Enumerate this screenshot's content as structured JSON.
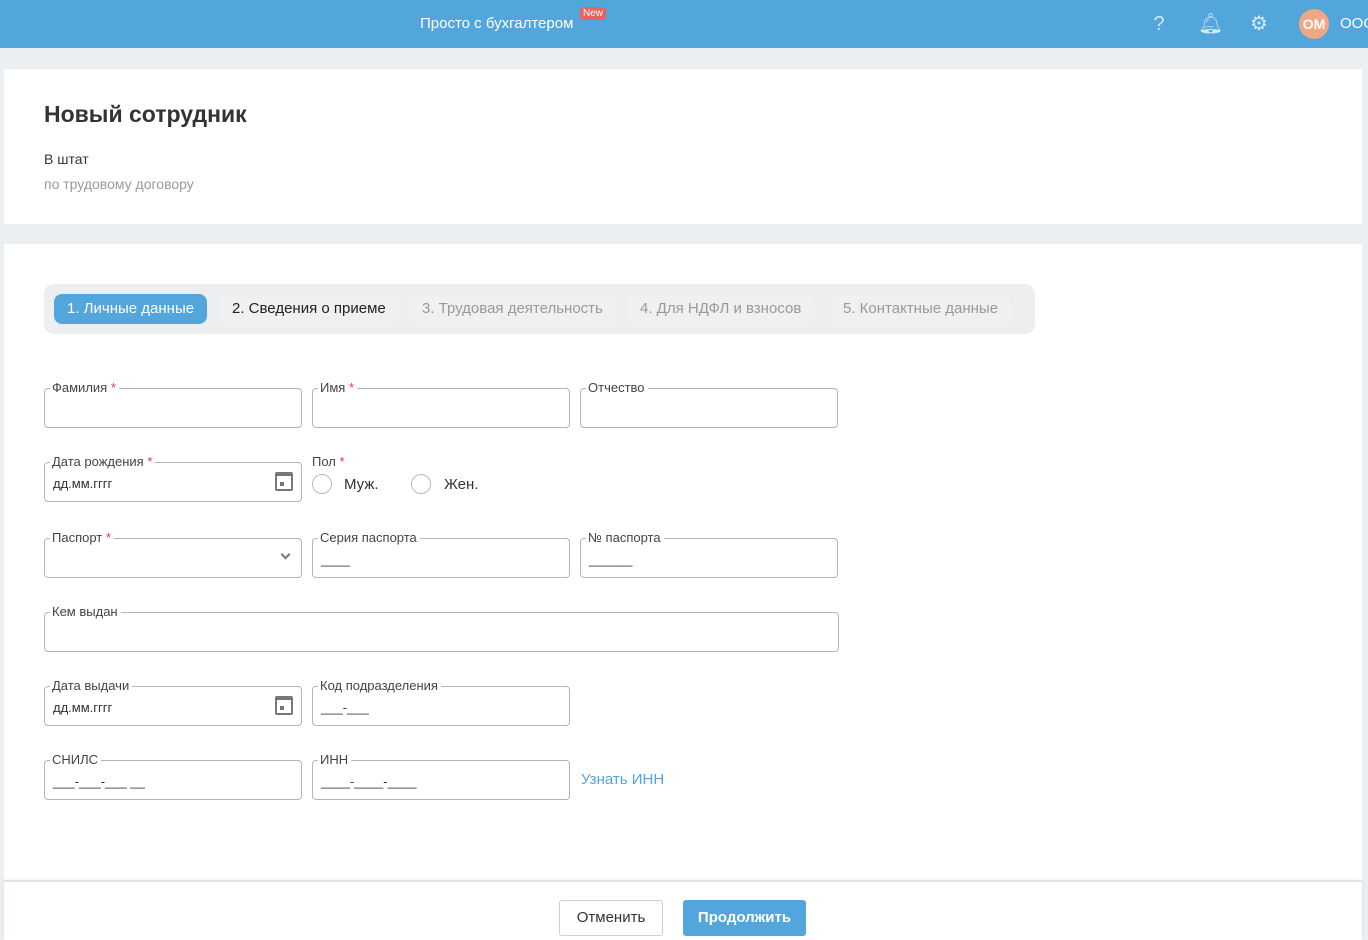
{
  "header": {
    "brand": "Просто с бухгалтером",
    "badge": "New",
    "avatar": "ОМ",
    "org": "ООО",
    "icons": [
      "help-icon",
      "bell-icon",
      "gear-icon"
    ]
  },
  "page": {
    "title": "Новый сотрудник",
    "subtitle": "В штат",
    "note": "по трудовому договору"
  },
  "tabs": [
    "1. Личные данные",
    "2. Сведения о приеме",
    "3. Трудовая деятельность",
    "4. Для НДФЛ и взносов",
    "5. Контактные данные"
  ],
  "form": {
    "last_name": "Фамилия",
    "first_name": "Имя",
    "middle_name": "Отчество",
    "birth_date": "Дата рождения",
    "birth_date_ph": "дд.мм.гггг",
    "gender": "Пол",
    "male": "Муж.",
    "female": "Жен.",
    "passport": "Паспорт",
    "series": "Серия паспорта",
    "series_ph": "____",
    "number": "№ паспорта",
    "number_ph": "______",
    "issued_by": "Кем выдан",
    "issue_date": "Дата выдачи",
    "issue_date_ph": "дд.мм.гггг",
    "dept_code": "Код подразделения",
    "dept_code_ph": "___-___",
    "snils": "СНИЛС",
    "snils_ph": "___-___-___ __",
    "inn": "ИНН",
    "inn_ph": "____-____-____",
    "find_inn": "Узнать ИНН",
    "required_mark": "*"
  },
  "footer": {
    "cancel": "Отменить",
    "continue": "Продолжить"
  }
}
